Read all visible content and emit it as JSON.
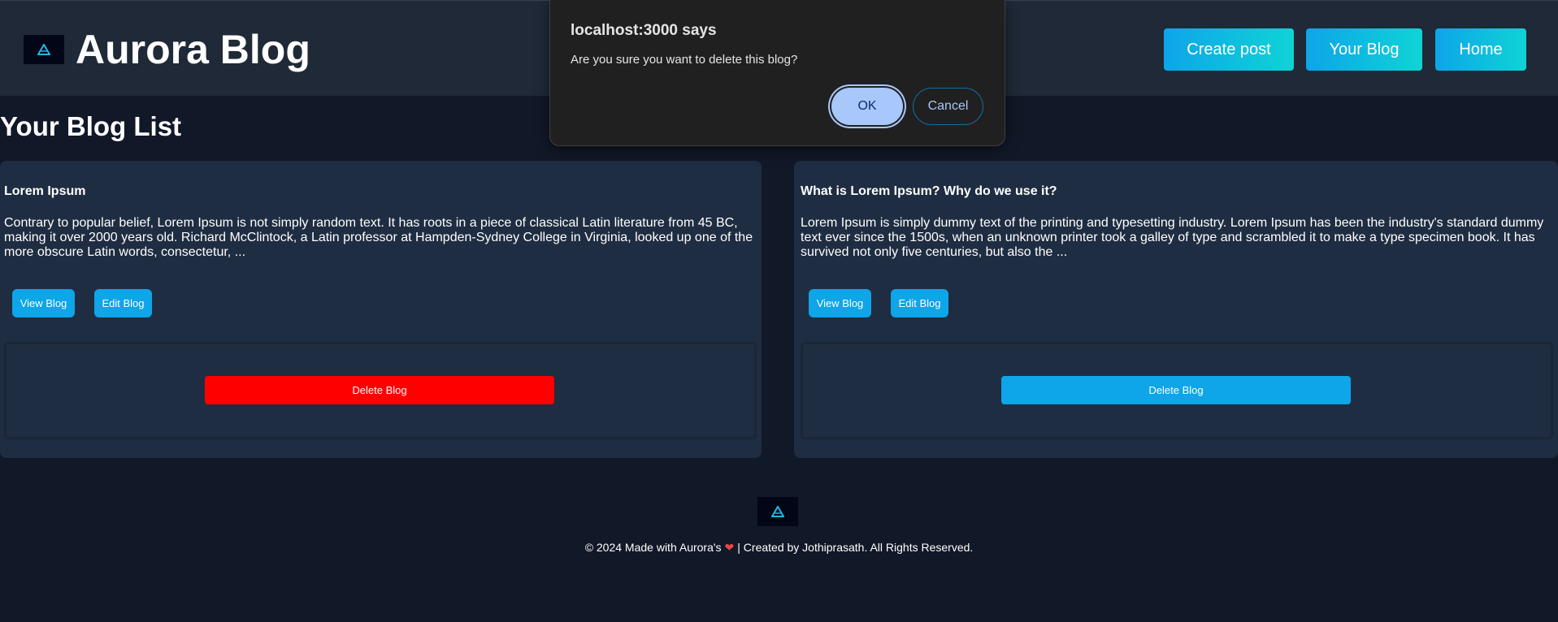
{
  "header": {
    "title": "Aurora Blog",
    "nav": {
      "create_post": "Create post",
      "your_blog": "Your Blog",
      "home": "Home"
    }
  },
  "main": {
    "heading": "Your Blog List",
    "blogs": [
      {
        "title": "Lorem Ipsum",
        "excerpt": "Contrary to popular belief, Lorem Ipsum is not simply random text. It has roots in a piece of classical Latin literature from 45 BC, making it over 2000 years old. Richard McClintock, a Latin professor at Hampden-Sydney College in Virginia, looked up one of the more obscure Latin words, consectetur, ...",
        "view_label": "View Blog",
        "edit_label": "Edit Blog",
        "delete_label": "Delete Blog",
        "delete_color": "#ff0000"
      },
      {
        "title": "What is Lorem Ipsum? Why do we use it?",
        "excerpt": "Lorem Ipsum is simply dummy text of the printing and typesetting industry. Lorem Ipsum has been the industry's standard dummy text ever since the 1500s, when an unknown printer took a galley of type and scrambled it to make a type specimen book. It has survived not only five centuries, but also the ...",
        "view_label": "View Blog",
        "edit_label": "Edit Blog",
        "delete_label": "Delete Blog",
        "delete_color": "#0ea5e9"
      }
    ]
  },
  "footer": {
    "text_before": "© 2024 Made with Aurora's",
    "text_after": "| Created by Jothiprasath. All Rights Reserved.",
    "heart_icon": "heart-icon"
  },
  "dialog": {
    "title": "localhost:3000 says",
    "message": "Are you sure you want to delete this blog?",
    "ok_label": "OK",
    "cancel_label": "Cancel"
  },
  "colors": {
    "background": "#111827",
    "surface": "#1f2937",
    "accent": "#0ea5e9",
    "accent_gradient_end": "#0fd3d6",
    "danger": "#ff0000",
    "dialog_bg": "#202020",
    "dialog_ok": "#a8c7fa"
  }
}
